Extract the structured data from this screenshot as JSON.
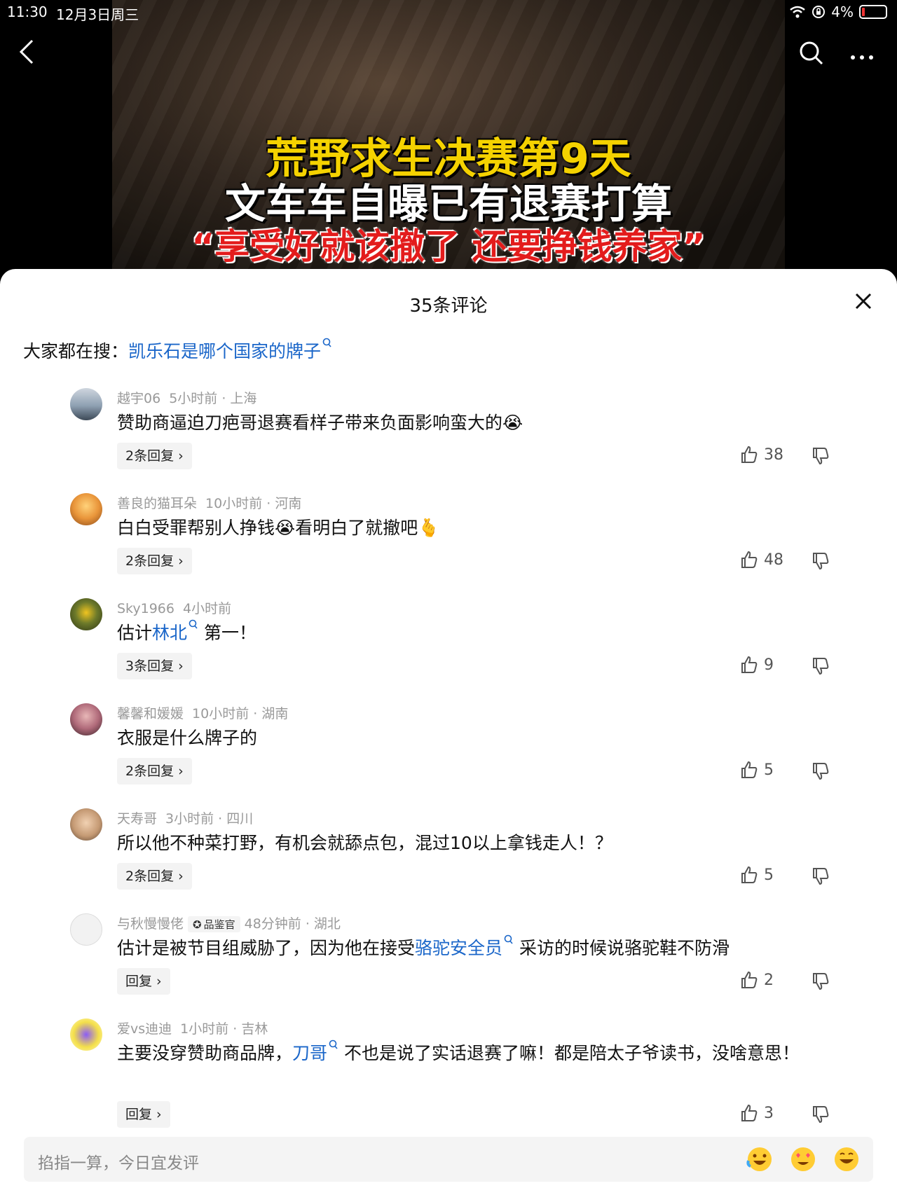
{
  "status_bar": {
    "time": "11:30",
    "date": "12月3日周三",
    "battery": "4%"
  },
  "video": {
    "caption_line1": "荒野求生决赛第9天",
    "caption_line2": "文车车自曝已有退赛打算",
    "caption_line3": "“享受好就该撤了 还要挣钱养家”"
  },
  "sheet": {
    "title": "35条评论",
    "hot_search_prefix": "大家都在搜：",
    "hot_search_link": "凯乐石是哪个国家的牌子"
  },
  "comments": [
    {
      "user": "越宇06",
      "time": "5小时前",
      "location": "上海",
      "text": "赞助商逼迫刀疤哥退赛看样子带来负面影响蛮大的",
      "replies": "2条回复",
      "likes": "38"
    },
    {
      "user": "善良的猫耳朵",
      "time": "10小时前",
      "location": "河南",
      "text_a": "白白受罪帮别人挣钱",
      "text_b": "看明白了就撤吧",
      "replies": "2条回复",
      "likes": "48"
    },
    {
      "user": "Sky1966",
      "time": "4小时前",
      "text_a": "估计",
      "link": "林北",
      "text_b": " 第一！",
      "replies": "3条回复",
      "likes": "9"
    },
    {
      "user": "馨馨和媛媛",
      "time": "10小时前",
      "location": "湖南",
      "text": "衣服是什么牌子的",
      "replies": "2条回复",
      "likes": "5"
    },
    {
      "user": "天寿哥",
      "time": "3小时前",
      "location": "四川",
      "text": "所以他不种菜打野，有机会就舔点包，混过10以上拿钱走人！？",
      "replies": "2条回复",
      "likes": "5"
    },
    {
      "user": "与秋慢慢佬",
      "badge": "品鉴官",
      "time": "48分钟前",
      "location": "湖北",
      "text_a": "估计是被节目组威胁了，因为他在接受",
      "link": "骆驼安全员",
      "text_b": " 采访的时候说骆驼鞋不防滑",
      "replies": "回复",
      "likes": "2"
    },
    {
      "user": "爱vs迪迪",
      "time": "1小时前",
      "location": "吉林",
      "text_a": "主要没穿赞助商品牌，",
      "link": "刀哥",
      "text_b": " 不也是说了实话退赛了嘛！都是陪太子爷读书，没啥意思！",
      "replies": "回复",
      "likes": "3"
    }
  ],
  "input": {
    "placeholder": "掐指一算，今日宜发评"
  },
  "colors": {
    "link": "#1a66c9",
    "caption_yellow": "#f5d200",
    "caption_red": "#e31c1c"
  }
}
